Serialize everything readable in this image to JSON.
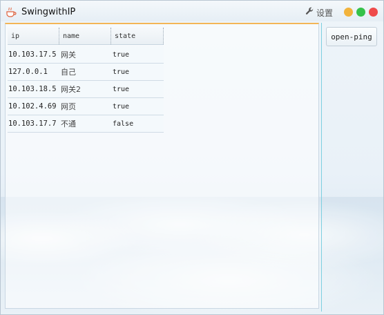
{
  "window": {
    "title": "SwingwithIP",
    "settings_label": "设置",
    "controls": [
      "minimize",
      "maximize",
      "close"
    ],
    "colors": {
      "minimize": "#f2b33c",
      "maximize": "#36c24a",
      "close": "#ef4b4b",
      "accent": "#f3b556"
    }
  },
  "table": {
    "headers": {
      "ip": "ip",
      "name": "name",
      "state": "state"
    },
    "rows": [
      {
        "ip": "10.103.17.5",
        "name": "网关",
        "state": "true"
      },
      {
        "ip": "127.0.0.1",
        "name": "自己",
        "state": "true"
      },
      {
        "ip": "10.103.18.5",
        "name": "网关2",
        "state": "true"
      },
      {
        "ip": "10.102.4.69",
        "name": "网页",
        "state": "true"
      },
      {
        "ip": "10.103.17.7",
        "name": "不通",
        "state": "false"
      }
    ]
  },
  "actions": {
    "ping_label": "open-ping"
  }
}
